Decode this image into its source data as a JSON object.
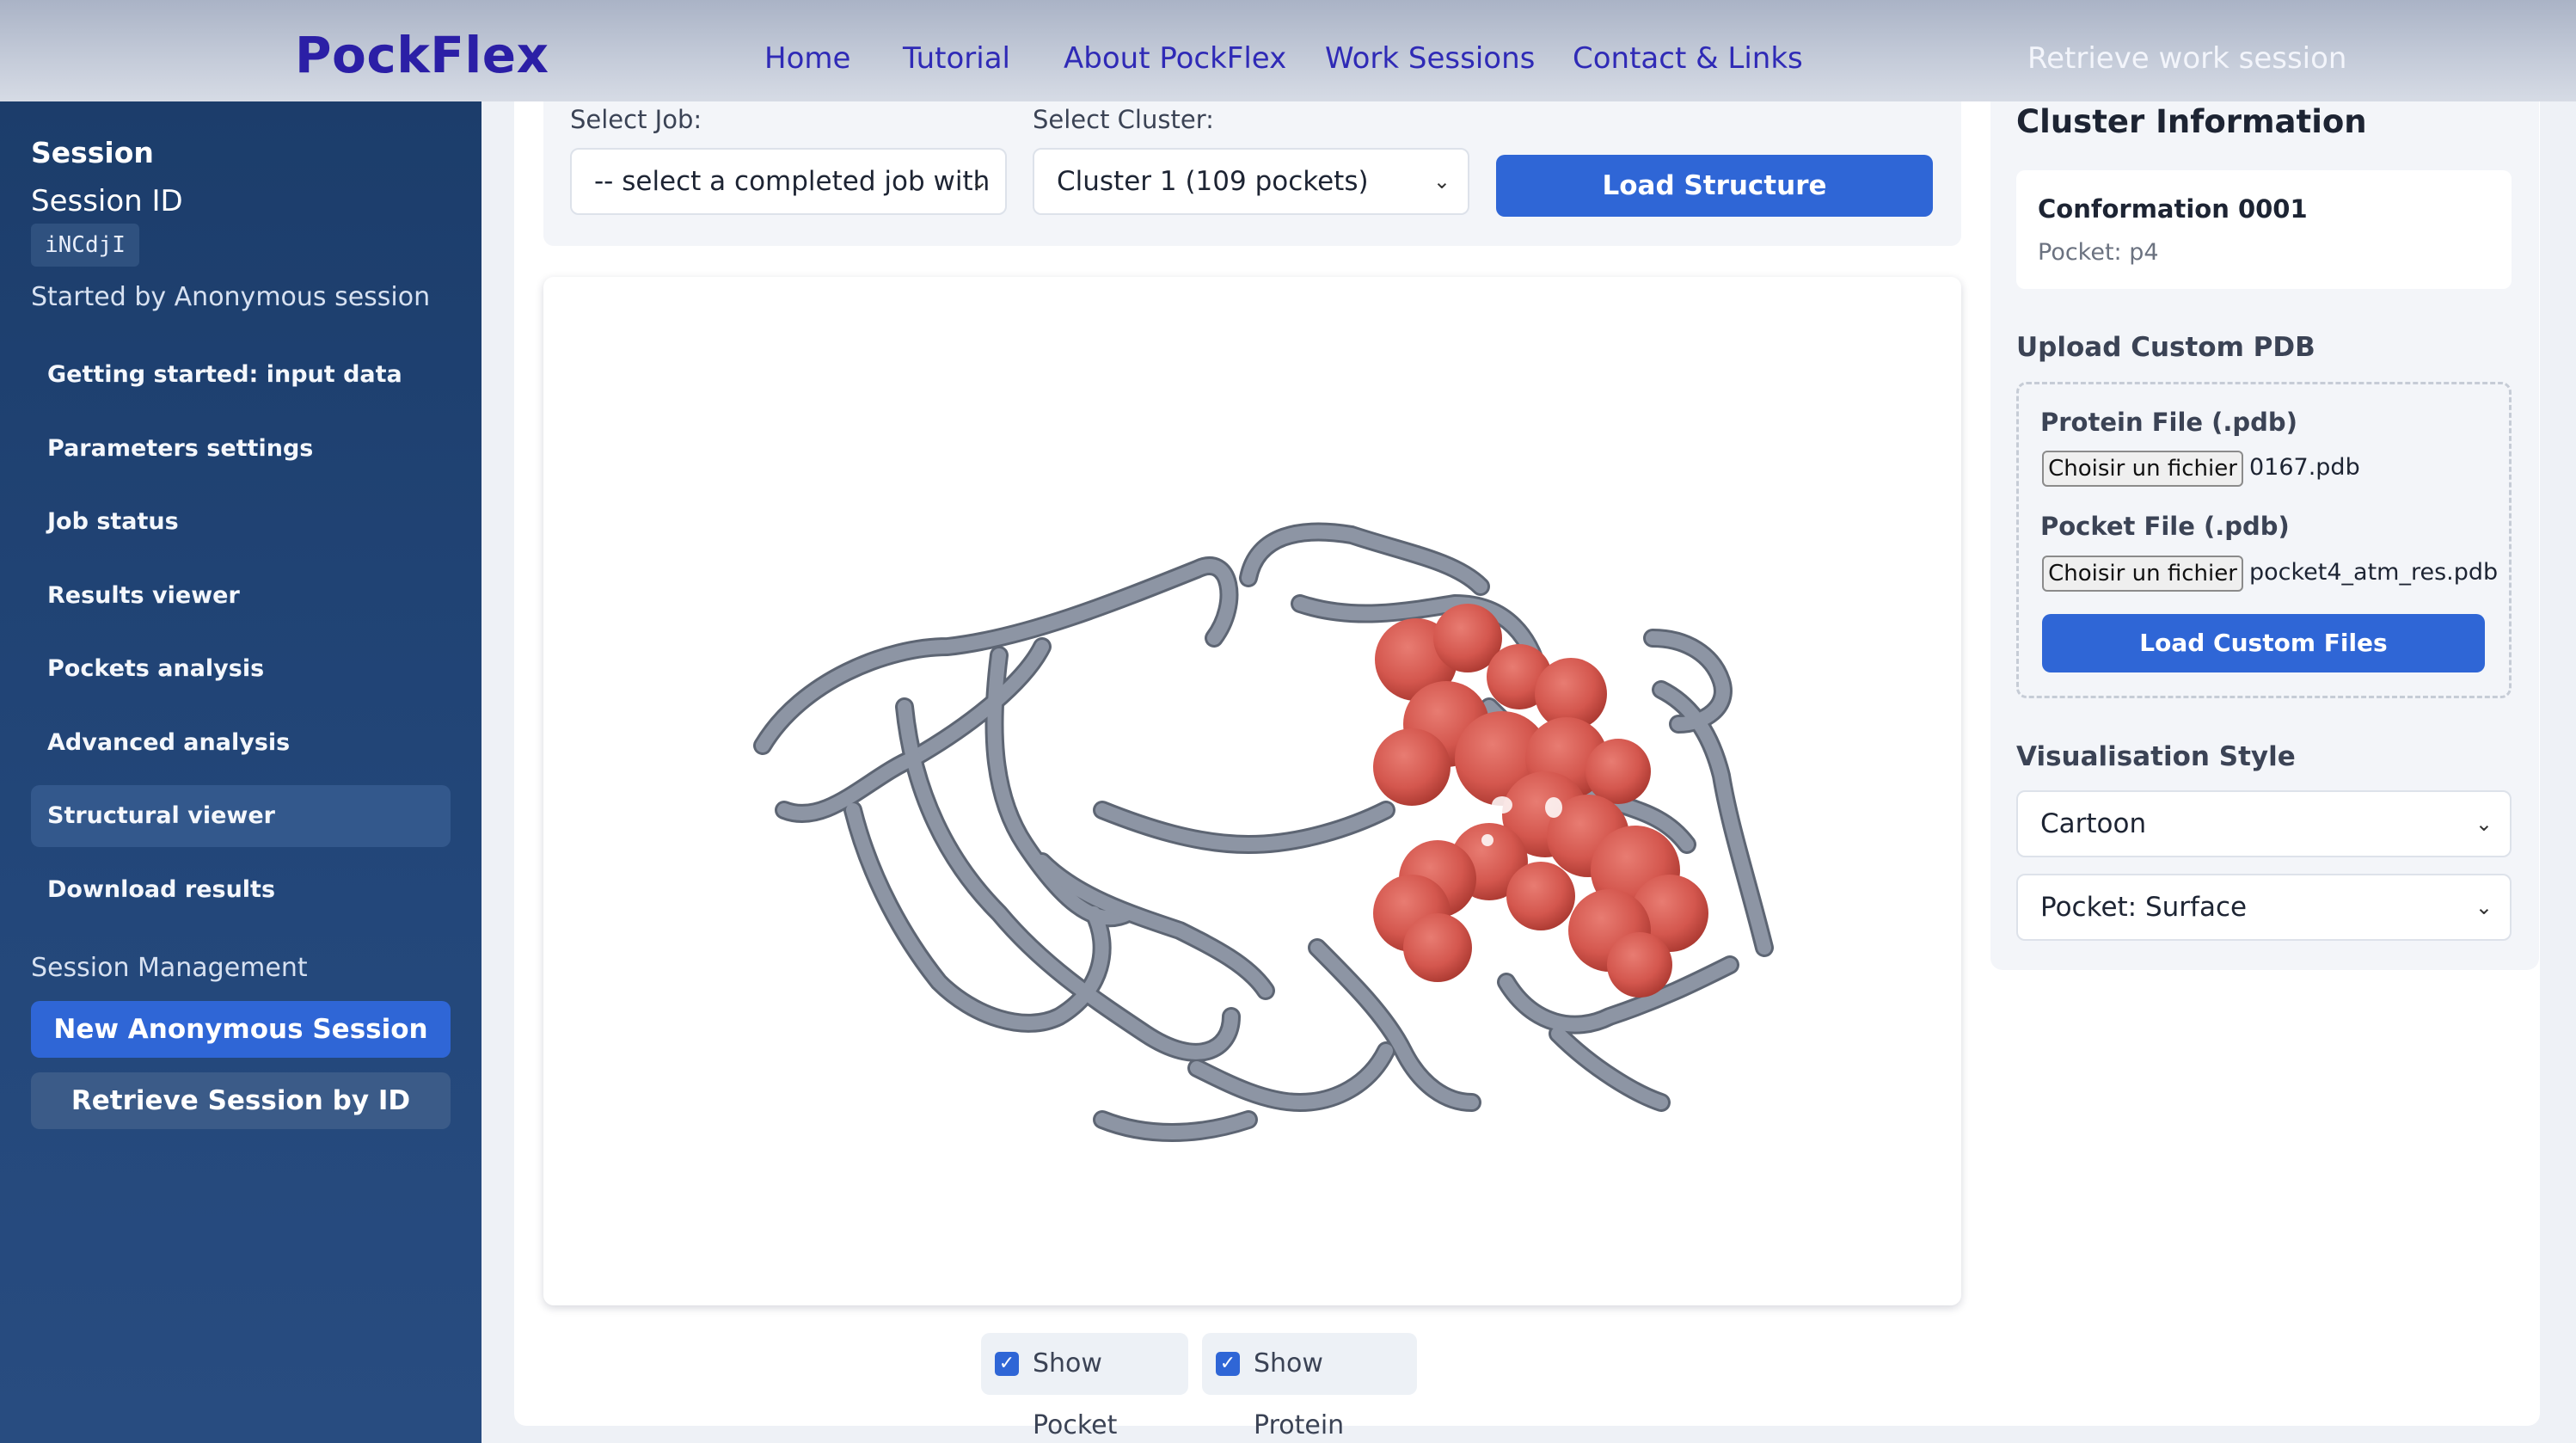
{
  "brand": "PockFlex",
  "nav": {
    "home": "Home",
    "tutorial": "Tutorial",
    "about": "About PockFlex",
    "sessions": "Work Sessions",
    "contact": "Contact & Links",
    "retrieve": "Retrieve work session"
  },
  "sidebar": {
    "title": "Session",
    "session_id_label": "Session ID",
    "session_id": "iNCdjI",
    "started_by": "Started by Anonymous session",
    "items": [
      {
        "label": "Getting started: input data"
      },
      {
        "label": "Parameters settings"
      },
      {
        "label": "Job status"
      },
      {
        "label": "Results viewer"
      },
      {
        "label": "Pockets analysis"
      },
      {
        "label": "Advanced analysis"
      },
      {
        "label": "Structural viewer",
        "active": true
      },
      {
        "label": "Download results"
      }
    ],
    "management_label": "Session Management",
    "new_session": "New Anonymous Session",
    "retrieve_session": "Retrieve Session by ID"
  },
  "controls": {
    "job_label": "Select Job:",
    "job_value": "-- select a completed job with",
    "cluster_label": "Select Cluster:",
    "cluster_value": "Cluster 1 (109 pockets)",
    "load_button": "Load Structure"
  },
  "viewer": {
    "show_pocket": "Show Pocket",
    "show_pocket_checked": true,
    "show_protein": "Show Protein",
    "show_protein_checked": true,
    "protein_color": "#8d95a4",
    "pocket_color": "#d4574e"
  },
  "cluster_info": {
    "heading": "Cluster Information",
    "conformation": "Conformation 0001",
    "pocket": "Pocket: p4"
  },
  "upload": {
    "heading": "Upload Custom PDB",
    "protein_label": "Protein File (.pdb)",
    "protein_button": "Choisir un fichier",
    "protein_file": "0167.pdb",
    "pocket_label": "Pocket File (.pdb)",
    "pocket_button": "Choisir un fichier",
    "pocket_file": "pocket4_atm_res.pdb",
    "load_button": "Load Custom Files"
  },
  "style": {
    "heading": "Visualisation Style",
    "main_style": "Cartoon",
    "pocket_style": "Pocket: Surface"
  },
  "colors": {
    "brand": "#2b1fa6",
    "accent": "#2f66d6",
    "sidebar": "#1f4272"
  }
}
